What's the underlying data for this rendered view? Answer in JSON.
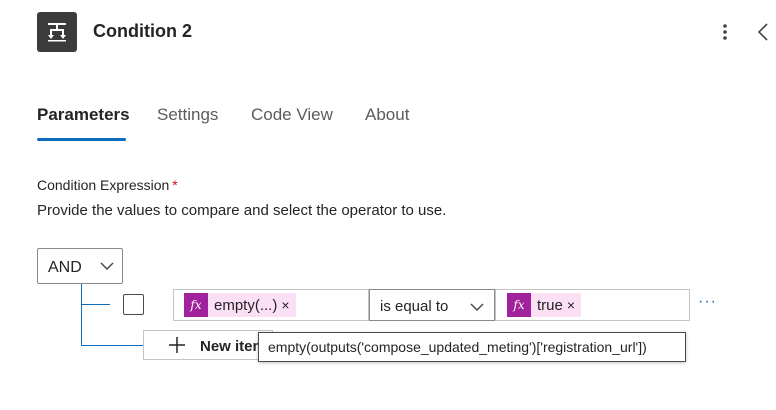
{
  "header": {
    "title": "Condition 2",
    "icon": "condition-icon",
    "icon_bg": "#3b3b3b"
  },
  "tabs": [
    {
      "label": "Parameters",
      "active": true
    },
    {
      "label": "Settings",
      "active": false
    },
    {
      "label": "Code View",
      "active": false
    },
    {
      "label": "About",
      "active": false
    }
  ],
  "condition": {
    "label": "Condition Expression",
    "required_mark": "*",
    "description": "Provide the values to compare and select the operator to use.",
    "group_operator": "AND",
    "row": {
      "left_token": "empty(...)",
      "operator": "is equal to",
      "right_token": "true",
      "token_fx": "fx",
      "remove_glyph": "×",
      "more_glyph": "···"
    },
    "new_item_label": "New item",
    "tooltip": "empty(outputs('compose_updated_meting')['registration_url'])"
  },
  "colors": {
    "accent": "#0f6cbd",
    "token_bg": "#fbe0f5",
    "fx_bg": "#a0229c",
    "required": "#c50f1f"
  }
}
